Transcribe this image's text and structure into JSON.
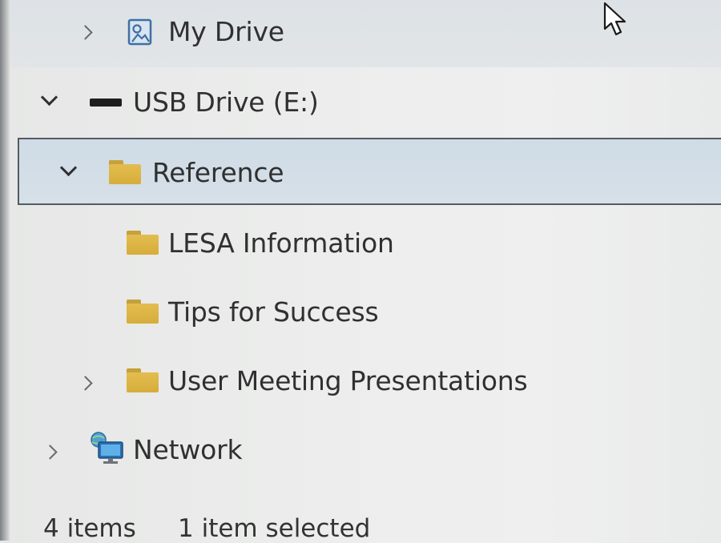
{
  "tree": {
    "items": [
      {
        "label": "My Drive",
        "state": "collapsed",
        "icon": "cloud-drive-icon"
      },
      {
        "label": "USB Drive (E:)",
        "state": "expanded",
        "icon": "usb-drive-icon"
      },
      {
        "label": "Reference",
        "state": "expanded",
        "icon": "folder-icon",
        "selected": true
      },
      {
        "label": "LESA Information",
        "state": "leaf",
        "icon": "folder-icon"
      },
      {
        "label": "Tips for Success",
        "state": "leaf",
        "icon": "folder-icon"
      },
      {
        "label": "User Meeting Presentations",
        "state": "collapsed",
        "icon": "folder-icon"
      },
      {
        "label": "Network",
        "state": "collapsed",
        "icon": "network-icon"
      }
    ]
  },
  "status": {
    "item_count": "4 items",
    "selection": "1 item selected"
  },
  "colors": {
    "selection_fill": "#d3dee7",
    "selection_border": "#555b63",
    "folder": "#dcb445"
  }
}
